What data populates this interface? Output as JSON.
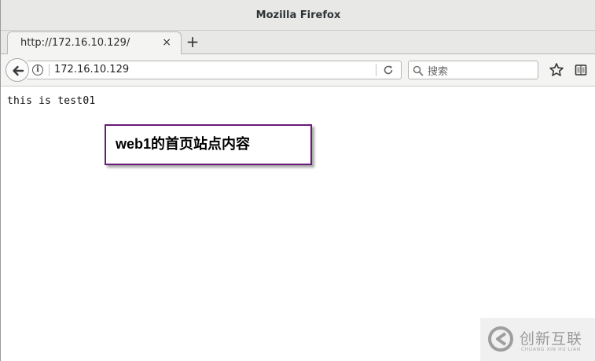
{
  "window": {
    "title": "Mozilla Firefox"
  },
  "tabs": [
    {
      "label": "http://172.16.10.129/",
      "close_glyph": "×"
    }
  ],
  "new_tab_glyph": "+",
  "navbar": {
    "url": "172.16.10.129",
    "search_placeholder": "搜索",
    "info_glyph": "i"
  },
  "page": {
    "body_text": "this is test01"
  },
  "annotation": {
    "text": "web1的首页站点内容",
    "border_color": "#6a1a7a"
  },
  "watermark": {
    "name": "创新互联",
    "sub": "CHUANG XIN HU LIAN"
  },
  "icons": {
    "back": "back-arrow-icon",
    "info": "info-icon",
    "reload": "reload-icon",
    "search": "search-icon",
    "bookmark": "star-icon",
    "reader": "reader-view-icon"
  }
}
